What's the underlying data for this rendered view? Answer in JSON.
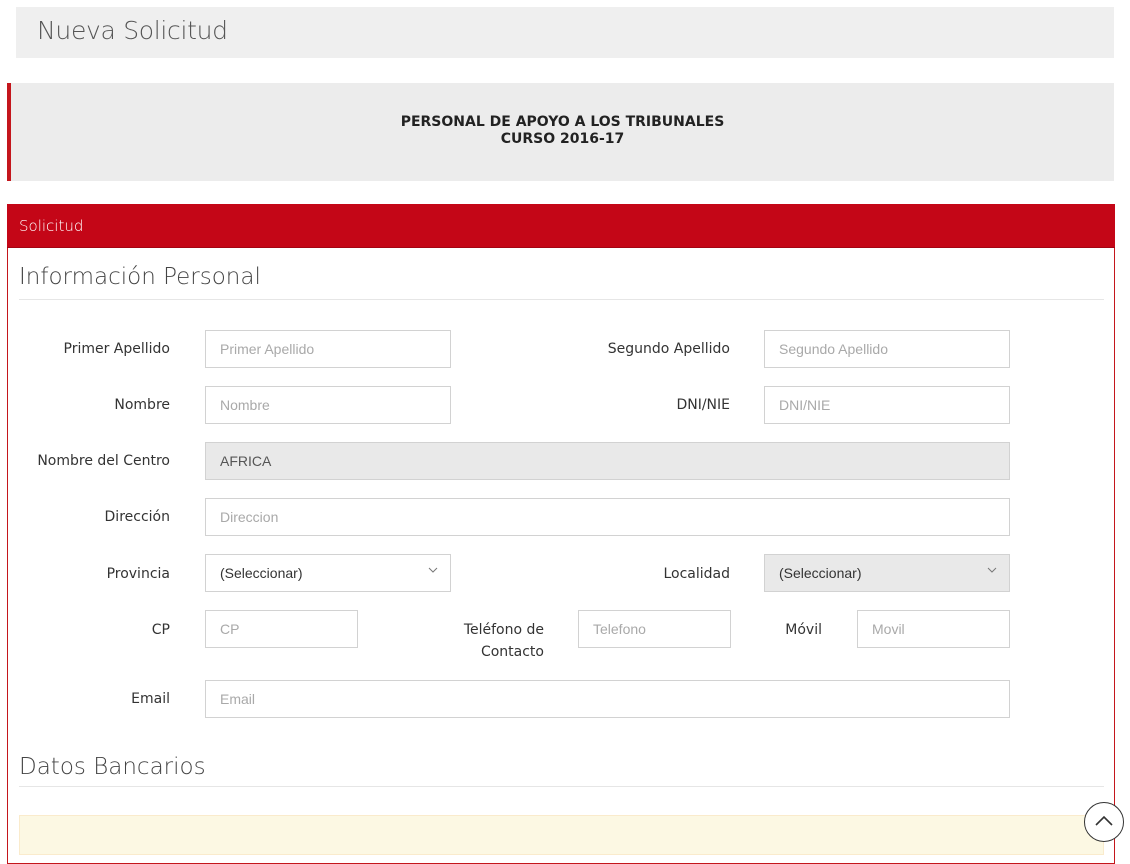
{
  "page": {
    "title": "Nueva Solicitud"
  },
  "banner": {
    "line1": "PERSONAL DE APOYO A LOS TRIBUNALES",
    "line2": "CURSO 2016-17"
  },
  "panel": {
    "heading": "Solicitud"
  },
  "personal": {
    "title": "Información Personal",
    "primer_apellido": {
      "label": "Primer Apellido",
      "placeholder": "Primer Apellido",
      "value": ""
    },
    "segundo_apellido": {
      "label": "Segundo Apellido",
      "placeholder": "Segundo Apellido",
      "value": ""
    },
    "nombre": {
      "label": "Nombre",
      "placeholder": "Nombre",
      "value": ""
    },
    "dni": {
      "label": "DNI/NIE",
      "placeholder": "DNI/NIE",
      "value": ""
    },
    "centro": {
      "label": "Nombre del Centro",
      "value": "AFRICA"
    },
    "direccion": {
      "label": "Dirección",
      "placeholder": "Direccion",
      "value": ""
    },
    "provincia": {
      "label": "Provincia",
      "selected": "(Seleccionar)"
    },
    "localidad": {
      "label": "Localidad",
      "selected": "(Seleccionar)"
    },
    "cp": {
      "label": "CP",
      "placeholder": "CP",
      "value": ""
    },
    "telefono": {
      "label_line1": "Teléfono de",
      "label_line2": "Contacto",
      "placeholder": "Telefono",
      "value": ""
    },
    "movil": {
      "label": "Móvil",
      "placeholder": "Movil",
      "value": ""
    },
    "email": {
      "label": "Email",
      "placeholder": "Email",
      "value": ""
    }
  },
  "bancarios": {
    "title": "Datos Bancarios"
  },
  "icons": {
    "scroll_top": "chevron-up-circle-icon",
    "select_arrow": "chevron-down-icon"
  },
  "colors": {
    "accent": "#c40617",
    "header_bg": "#efefef",
    "alert_bg": "#fcf8e3"
  }
}
